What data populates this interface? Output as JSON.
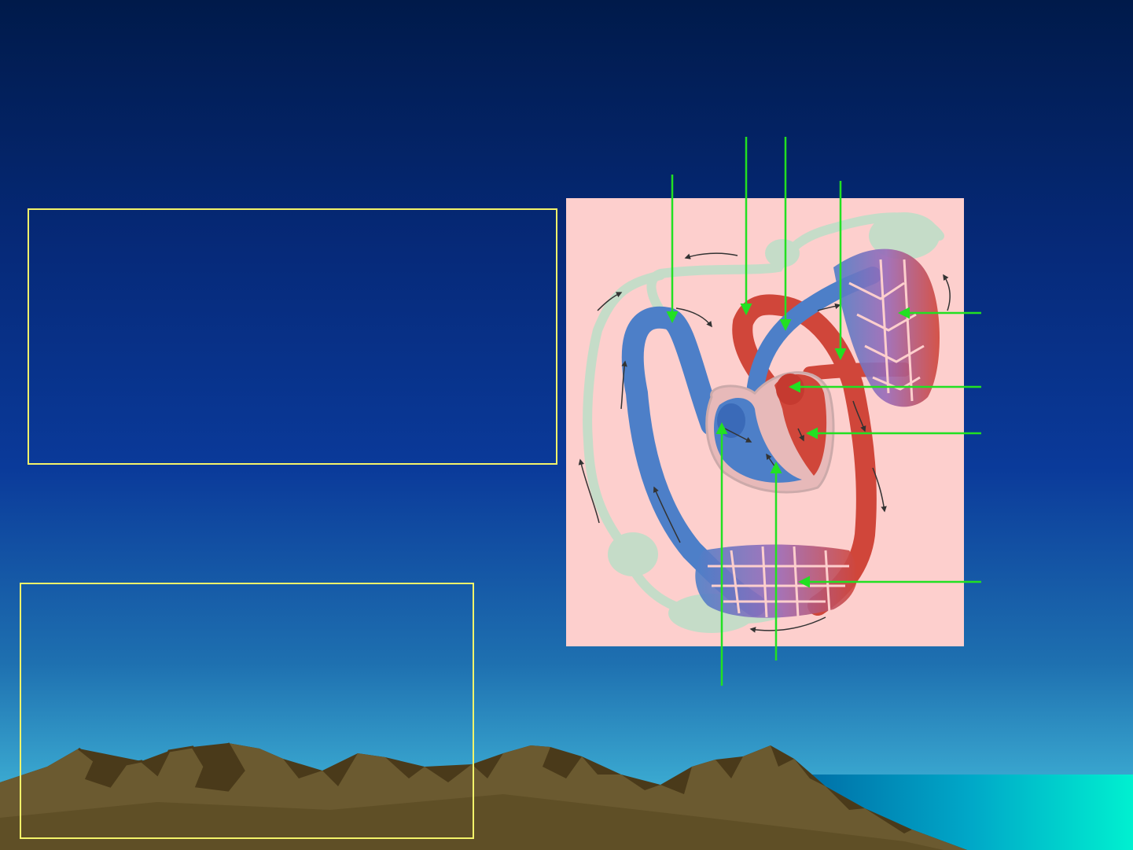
{
  "slide": {
    "title": "",
    "text_box_top": "",
    "text_box_bottom": ""
  },
  "diagram": {
    "subject": "circulatory-system",
    "colors": {
      "oxygenated": "#d0463a",
      "deoxygenated": "#4d7fc8",
      "lymph": "#c5dcc8",
      "panel": "#fdcfcd",
      "pointer": "#22e022",
      "frame": "#f4f46a"
    },
    "pointer_labels": [
      "",
      "",
      "",
      "",
      "",
      "",
      "",
      "",
      "",
      ""
    ]
  }
}
